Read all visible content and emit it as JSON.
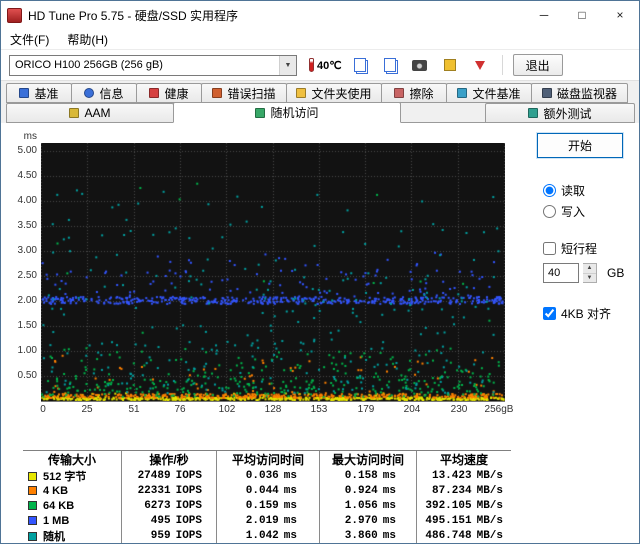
{
  "window": {
    "title": "HD Tune Pro 5.75 - 硬盘/SSD 实用程序",
    "minimize_glyph": "─",
    "maximize_glyph": "□",
    "close_glyph": "×"
  },
  "menu": {
    "file": "文件(F)",
    "help": "帮助(H)"
  },
  "toolbar": {
    "drive_select": "ORICO H100 256GB (256 gB)",
    "combo_arrow": "▼",
    "temperature": "40℃",
    "exit_label": "退出"
  },
  "tabs": {
    "row1": [
      {
        "label": "基准"
      },
      {
        "label": "信息"
      },
      {
        "label": "健康"
      },
      {
        "label": "错误扫描"
      },
      {
        "label": "文件夹使用"
      },
      {
        "label": "擦除"
      },
      {
        "label": "文件基准"
      },
      {
        "label": "磁盘监视器"
      }
    ],
    "row2": [
      {
        "label": "AAM",
        "active": false
      },
      {
        "label": "随机访问",
        "active": true
      },
      {
        "label": "额外测试",
        "active": false
      }
    ]
  },
  "side_panel": {
    "start_label": "开始",
    "read_label": "读取",
    "write_label": "写入",
    "short_stroke_label": "短行程",
    "capacity_value": "40",
    "capacity_unit": "GB",
    "spinner_up": "▲",
    "spinner_down": "▼",
    "align_label": "4KB 对齐"
  },
  "chart_data": {
    "type": "scatter",
    "title": "随机访问时间散点图",
    "ylabel": "ms",
    "xlabel": "",
    "ylim": [
      0,
      5.0
    ],
    "xlim": [
      0,
      256
    ],
    "x_ticks": [
      "0",
      "25",
      "51",
      "76",
      "102",
      "128",
      "153",
      "179",
      "204",
      "230",
      "256gB"
    ],
    "y_ticks": [
      "5.00",
      "4.50",
      "4.00",
      "3.50",
      "3.00",
      "2.50",
      "2.00",
      "1.50",
      "1.00",
      "0.50"
    ],
    "background": "#121212",
    "grid_color": "#4a4a4a",
    "legend_position": "table-below",
    "series": [
      {
        "name": "512 字节",
        "color": "#e6e600",
        "count": 520,
        "avg_ms": 0.036,
        "max_ms": 0.158,
        "iops": 27489,
        "avg_speed_mbs": 13.423,
        "layers": [
          {
            "frac": 0.95,
            "min": 0.02,
            "max": 0.07
          },
          {
            "frac": 0.05,
            "min": 0.07,
            "max": 0.16
          }
        ]
      },
      {
        "name": "4 KB",
        "color": "#ff8000",
        "count": 430,
        "avg_ms": 0.044,
        "max_ms": 0.924,
        "iops": 22331,
        "avg_speed_mbs": 87.234,
        "layers": [
          {
            "frac": 0.9,
            "min": 0.06,
            "max": 0.14
          },
          {
            "frac": 0.1,
            "min": 0.14,
            "max": 0.92
          }
        ]
      },
      {
        "name": "64 KB",
        "color": "#00b44b",
        "count": 340,
        "avg_ms": 0.159,
        "max_ms": 1.056,
        "iops": 6273,
        "avg_speed_mbs": 392.105,
        "layers": [
          {
            "frac": 0.68,
            "min": 0.08,
            "max": 0.5
          },
          {
            "frac": 0.27,
            "min": 0.5,
            "max": 1.06
          },
          {
            "frac": 0.05,
            "min": 1.1,
            "max": 4.4
          }
        ]
      },
      {
        "name": "1 MB",
        "color": "#3355ff",
        "count": 540,
        "avg_ms": 2.019,
        "max_ms": 2.97,
        "iops": 495,
        "avg_speed_mbs": 495.151,
        "layers": [
          {
            "frac": 0.8,
            "min": 1.94,
            "max": 2.08
          },
          {
            "frac": 0.17,
            "min": 2.05,
            "max": 2.6
          },
          {
            "frac": 0.03,
            "min": 2.6,
            "max": 2.97
          }
        ]
      },
      {
        "name": "随机",
        "color": "#00a0a0",
        "count": 300,
        "avg_ms": 1.042,
        "max_ms": 3.86,
        "iops": 959,
        "avg_speed_mbs": 486.748,
        "layers": [
          {
            "frac": 0.5,
            "min": 0.15,
            "max": 1.2
          },
          {
            "frac": 0.33,
            "min": 1.2,
            "max": 2.6
          },
          {
            "frac": 0.17,
            "min": 2.6,
            "max": 4.3
          }
        ]
      }
    ]
  },
  "table": {
    "headers": [
      "传输大小",
      "操作/秒",
      "平均访问时间",
      "最大访问时间",
      "平均速度"
    ],
    "rows": [
      {
        "swatch": "#e6e600",
        "size": "512 字节",
        "ops": "27489",
        "ops_unit": "IOPS",
        "avg": "0.036",
        "avg_unit": "ms",
        "max": "0.158",
        "max_unit": "ms",
        "speed": "13.423",
        "speed_unit": "MB/s"
      },
      {
        "swatch": "#ff8000",
        "size": "4 KB",
        "ops": "22331",
        "ops_unit": "IOPS",
        "avg": "0.044",
        "avg_unit": "ms",
        "max": "0.924",
        "max_unit": "ms",
        "speed": "87.234",
        "speed_unit": "MB/s"
      },
      {
        "swatch": "#00b44b",
        "size": "64 KB",
        "ops": "6273",
        "ops_unit": "IOPS",
        "avg": "0.159",
        "avg_unit": "ms",
        "max": "1.056",
        "max_unit": "ms",
        "speed": "392.105",
        "speed_unit": "MB/s"
      },
      {
        "swatch": "#3355ff",
        "size": "1 MB",
        "ops": "495",
        "ops_unit": "IOPS",
        "avg": "2.019",
        "avg_unit": "ms",
        "max": "2.970",
        "max_unit": "ms",
        "speed": "495.151",
        "speed_unit": "MB/s"
      },
      {
        "swatch": "#00a0a0",
        "size": "随机",
        "ops": "959",
        "ops_unit": "IOPS",
        "avg": "1.042",
        "avg_unit": "ms",
        "max": "3.860",
        "max_unit": "ms",
        "speed": "486.748",
        "speed_unit": "MB/s"
      }
    ]
  }
}
